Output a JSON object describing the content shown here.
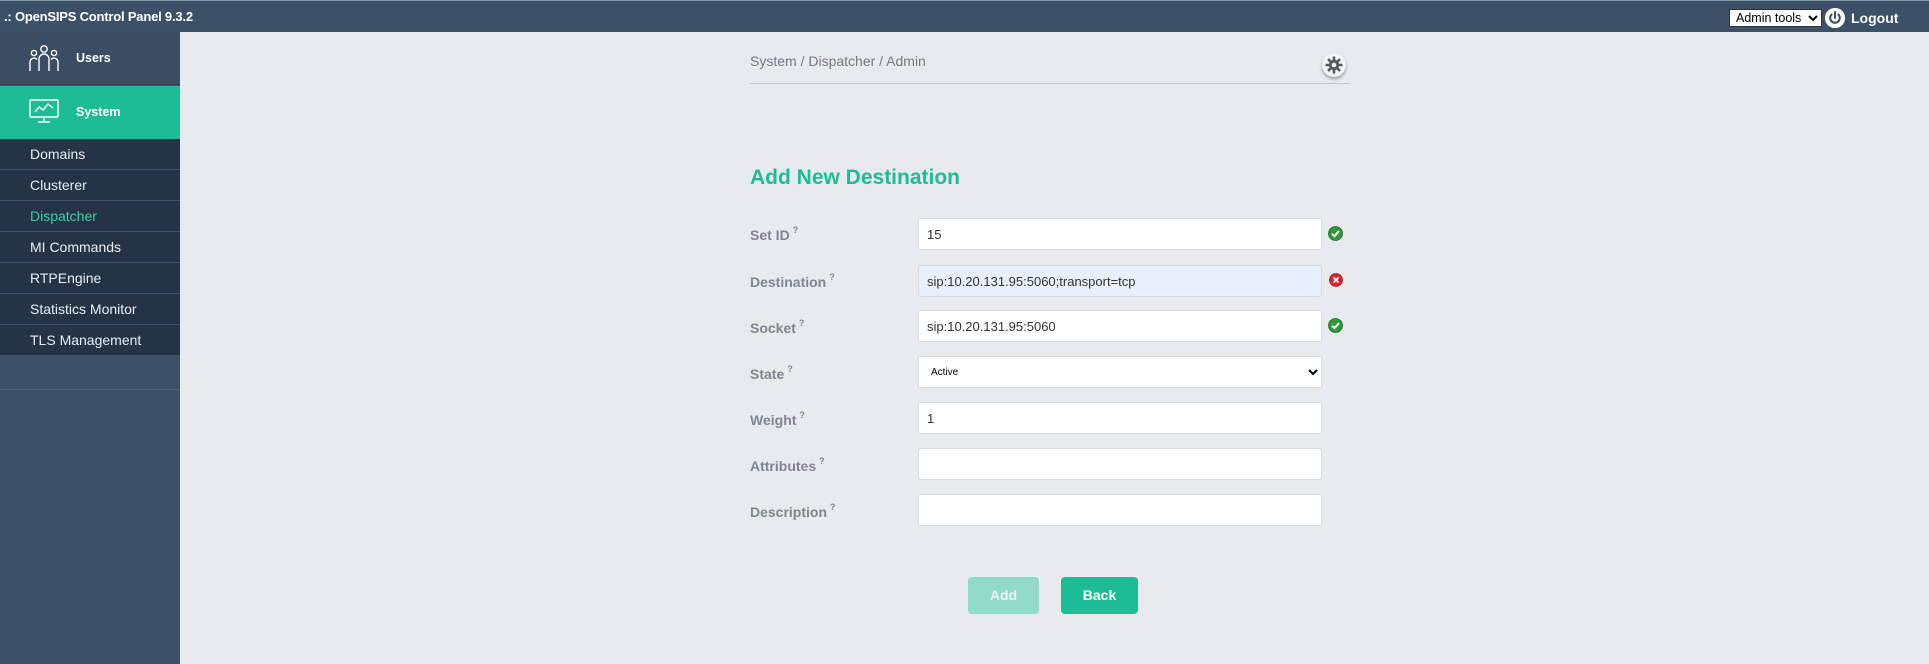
{
  "app": {
    "title": ".: OpenSIPS Control Panel 9.3.2"
  },
  "topbar": {
    "admin_tools": {
      "selected": "Admin tools",
      "options": [
        "Admin tools"
      ]
    },
    "logout_label": "Logout",
    "logout_icon": "power-icon"
  },
  "sidebar": {
    "main": [
      {
        "label": "Users",
        "icon": "users-icon"
      },
      {
        "label": "System",
        "icon": "system-monitor-icon",
        "active": true
      }
    ],
    "items": [
      {
        "label": "Domains"
      },
      {
        "label": "Clusterer"
      },
      {
        "label": "Dispatcher",
        "active": true
      },
      {
        "label": "MI Commands"
      },
      {
        "label": "RTPEngine"
      },
      {
        "label": "Statistics Monitor"
      },
      {
        "label": "TLS Management"
      }
    ]
  },
  "breadcrumb": "System / Dispatcher / Admin",
  "settings_icon": "gear-icon",
  "form": {
    "title": "Add New Destination",
    "help_marker": "?",
    "fields": [
      {
        "label": "Set ID",
        "value": "15",
        "status": "valid"
      },
      {
        "label": "Destination",
        "value": "sip:10.20.131.95:5060;transport=tcp",
        "status": "invalid"
      },
      {
        "label": "Socket",
        "value": "sip:10.20.131.95:5060",
        "status": "valid"
      },
      {
        "label": "State",
        "value": "Active",
        "options": [
          "Active"
        ]
      },
      {
        "label": "Weight",
        "value": "1"
      },
      {
        "label": "Attributes",
        "value": ""
      },
      {
        "label": "Description",
        "value": ""
      }
    ],
    "add_label": "Add",
    "back_label": "Back"
  },
  "colors": {
    "accent": "#1ebc96",
    "sidebar": "#3c5068",
    "valid": "#2e9a3a",
    "invalid": "#d9262e"
  }
}
